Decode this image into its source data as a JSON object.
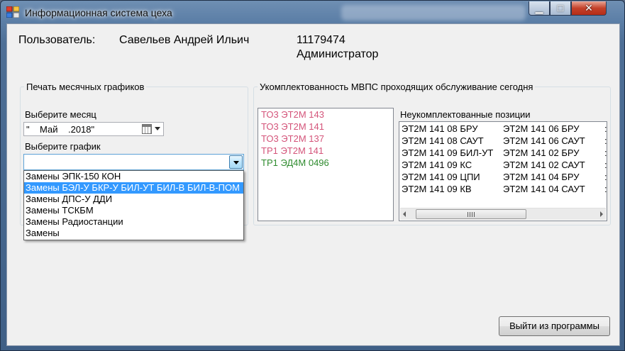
{
  "window": {
    "title": "Информационная система цеха",
    "controls": {
      "minimize": "▁",
      "maximize": "□",
      "close": "✕"
    }
  },
  "user": {
    "label": "Пользователь:",
    "name": "Савельев Андрей Ильич",
    "id": "11179474",
    "role": "Администратор"
  },
  "print_group": {
    "legend": "Печать месячных графиков",
    "month_label": "Выберите месяц",
    "month_value": "\"    Май    .2018\"",
    "schedule_label": "Выберите график",
    "schedule_value": "",
    "options": [
      "Замены ЭПК-150 КОН",
      "Замены БЭЛ-У БКР-У БИЛ-УТ БИЛ-В БИЛ-В-ПОМ",
      "Замены ДПС-У ДДИ",
      "Замены ТСКБМ",
      "Замены Радиостанции",
      "Замены"
    ],
    "selected_option": 1
  },
  "staffing_group": {
    "legend": "Укомплектованность МВПС проходящих обслуживание сегодня",
    "trains": [
      {
        "text": "ТО3 ЭТ2М 143",
        "color": "#d4547a"
      },
      {
        "text": "ТО3 ЭТ2М 141",
        "color": "#d4547a"
      },
      {
        "text": "ТО3 ЭТ2М 137",
        "color": "#d4547a"
      },
      {
        "text": "ТР1 ЭТ2М 141",
        "color": "#d4547a"
      },
      {
        "text": "ТР1 ЭД4М 0496",
        "color": "#2e8b2e"
      }
    ],
    "incomplete_label": "Неукомплектованные позиции",
    "incomplete_col1": [
      "ЭТ2М 141 08 БРУ",
      "ЭТ2М 141 08 САУТ",
      "ЭТ2М 141 09 БИЛ-УТ",
      "ЭТ2М 141 09 КС",
      "ЭТ2М 141 09 ЦПИ",
      "ЭТ2М 141 09 КВ"
    ],
    "incomplete_col2": [
      "ЭТ2М 141 06 БРУ",
      "ЭТ2М 141 06 САУТ",
      "ЭТ2М 141 02 БРУ",
      "ЭТ2М 141 02 САУТ",
      "ЭТ2М 141 04 БРУ",
      "ЭТ2М 141 04 САУТ"
    ],
    "incomplete_col3": [
      ":",
      ":",
      ":",
      ":",
      ":",
      ":"
    ]
  },
  "exit_button": "Выйти из программы",
  "colors": {
    "selection": "#3399ff",
    "title_bar": "#5b7ea6"
  }
}
